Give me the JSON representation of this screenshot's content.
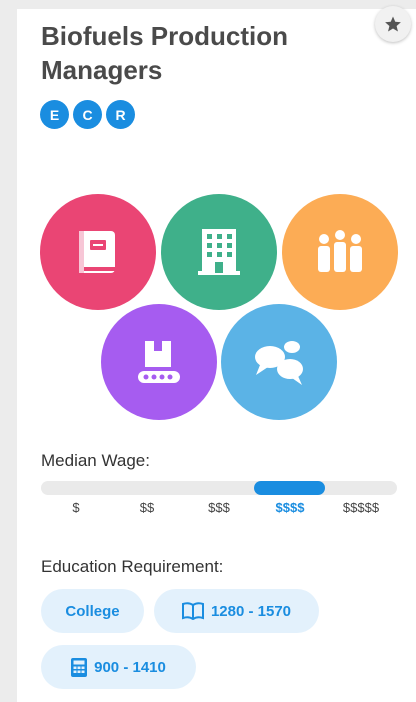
{
  "title": "Biofuels Production Managers",
  "badges": [
    "E",
    "C",
    "R"
  ],
  "category_icons": [
    {
      "icon": "book-icon",
      "color": "#ea4574"
    },
    {
      "icon": "office-building-icon",
      "color": "#3fb08a"
    },
    {
      "icon": "people-group-icon",
      "color": "#fcac55"
    },
    {
      "icon": "conveyor-box-icon",
      "color": "#a65cf0"
    },
    {
      "icon": "chat-bubbles-icon",
      "color": "#5bb3e6"
    }
  ],
  "wage": {
    "label": "Median Wage:",
    "ticks": [
      "$",
      "$$",
      "$$$",
      "$$$$",
      "$$$$$"
    ],
    "selected": "$$$$"
  },
  "education": {
    "label": "Education Requirement:",
    "level": "College",
    "sat_range": "1280 - 1570",
    "act_range": "900 - 1410"
  },
  "colors": {
    "accent": "#1a8de0",
    "pill_bg": "#e3f1fc",
    "title": "#4a4a4a"
  }
}
